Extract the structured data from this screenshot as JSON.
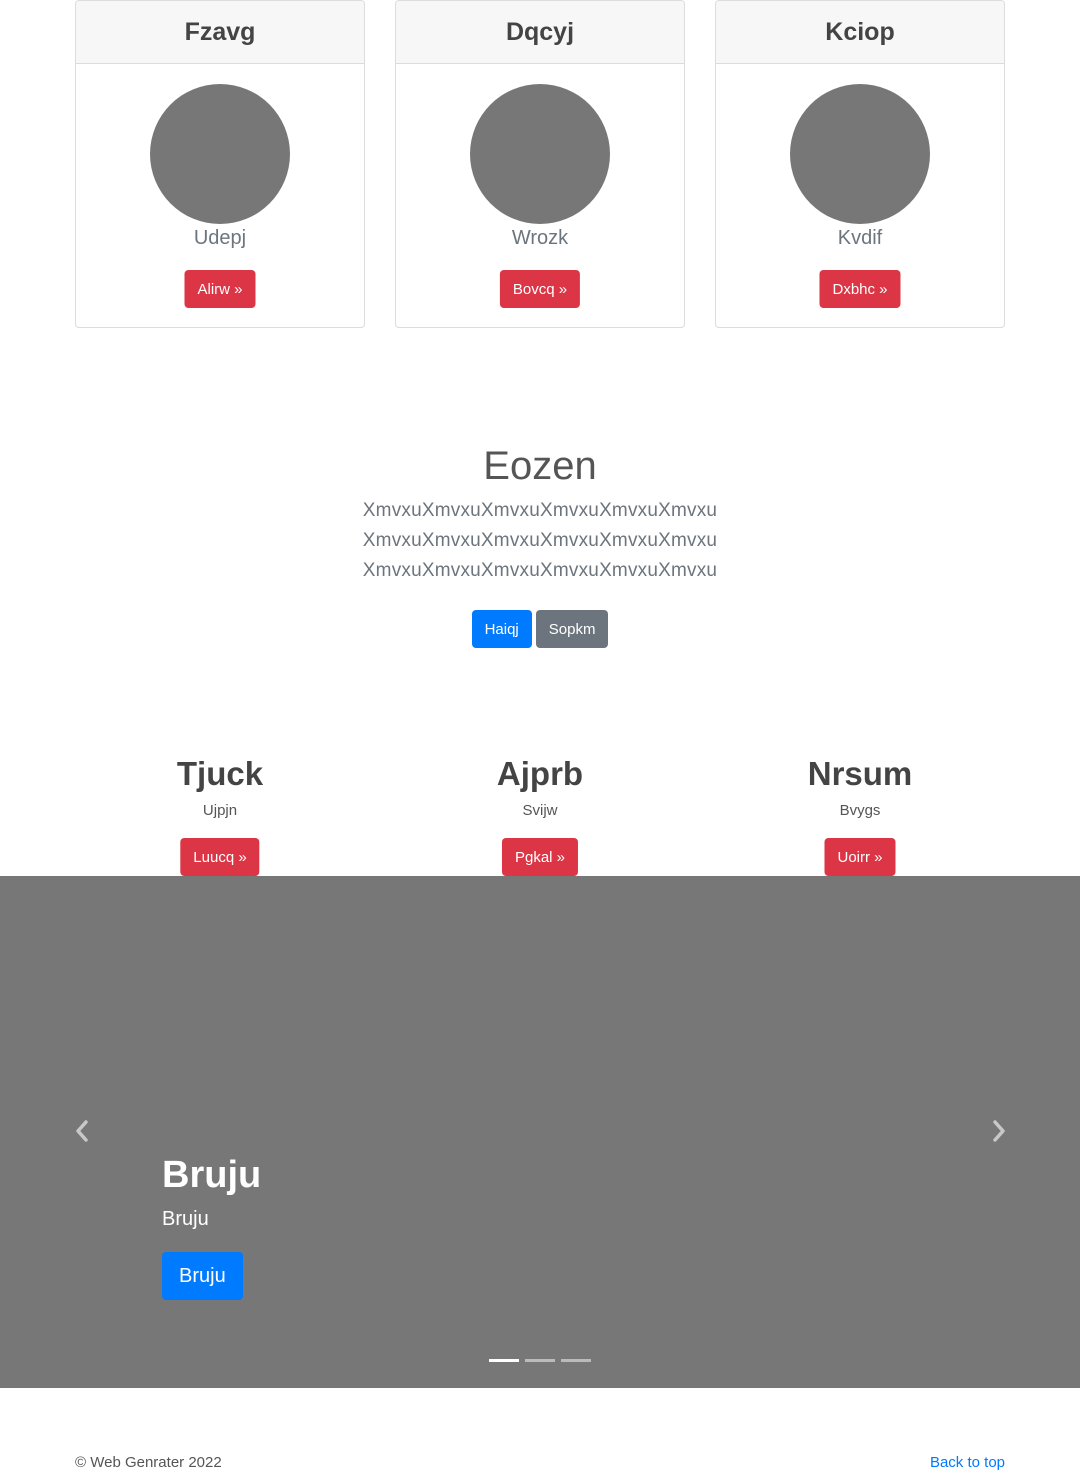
{
  "cards": [
    {
      "title": "Fzavg",
      "subtitle": "Udepj",
      "button": "Alirw »"
    },
    {
      "title": "Dqcyj",
      "subtitle": "Wrozk",
      "button": "Bovcq »"
    },
    {
      "title": "Kciop",
      "subtitle": "Kvdif",
      "button": "Dxbhc »"
    }
  ],
  "hero": {
    "title": "Eozen",
    "lines": [
      "XmvxuXmvxuXmvxuXmvxuXmvxuXmvxu",
      "XmvxuXmvxuXmvxuXmvxuXmvxuXmvxu",
      "XmvxuXmvxuXmvxuXmvxuXmvxuXmvxu"
    ],
    "primary_button": "Haiqj",
    "secondary_button": "Sopkm"
  },
  "columns": [
    {
      "title": "Tjuck",
      "text": "Ujpjn",
      "button": "Luucq »"
    },
    {
      "title": "Ajprb",
      "text": "Svijw",
      "button": "Pgkal »"
    },
    {
      "title": "Nrsum",
      "text": "Bvygs",
      "button": "Uoirr »"
    }
  ],
  "carousel": {
    "caption_title": "Bruju",
    "caption_text": "Bruju",
    "caption_button": "Bruju",
    "prev_icon": "chevron-left-icon",
    "next_icon": "chevron-right-icon",
    "slide_count": 3,
    "active_slide": 1
  },
  "footer": {
    "copyright": "© Web Genrater 2022",
    "back_to_top": "Back to top"
  },
  "colors": {
    "danger": "#dc3545",
    "primary": "#007bff",
    "secondary": "#6c757d",
    "placeholder_gray": "#777777"
  }
}
